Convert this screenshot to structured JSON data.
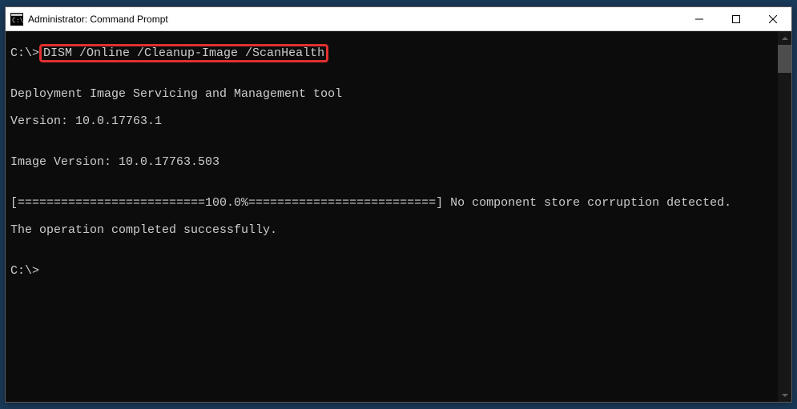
{
  "titlebar": {
    "title": "Administrator: Command Prompt"
  },
  "terminal": {
    "prompt1_path": "C:\\>",
    "command1": "DISM /Online /Cleanup-Image /ScanHealth",
    "blank1": "",
    "line_tool": "Deployment Image Servicing and Management tool",
    "line_version": "Version: 10.0.17763.1",
    "blank2": "",
    "line_imgver": "Image Version: 10.0.17763.503",
    "blank3": "",
    "line_progress": "[==========================100.0%==========================] No component store corruption detected.",
    "line_success": "The operation completed successfully.",
    "blank4": "",
    "prompt2_path": "C:\\>"
  }
}
